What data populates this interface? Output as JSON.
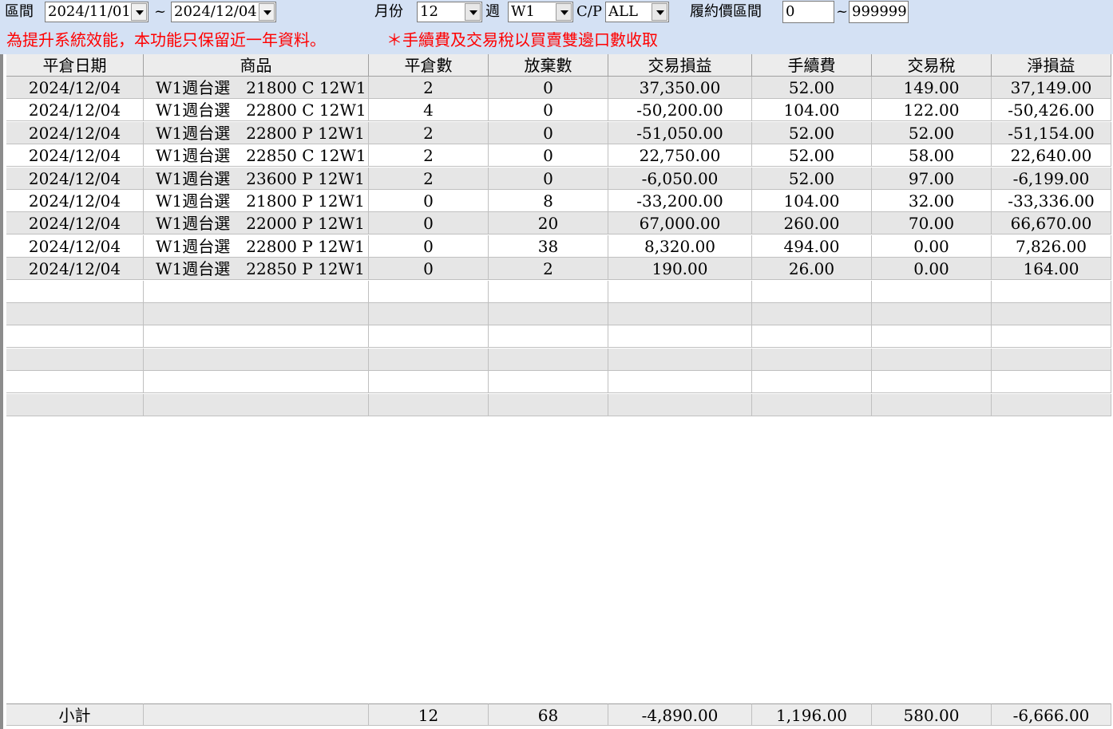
{
  "filters": {
    "range_label": "區間",
    "date_from": "2024/11/01",
    "tilde": "~",
    "date_to": "2024/12/04",
    "month_label": "月份",
    "month_value": "12",
    "week_label": "週",
    "week_value": "W1",
    "cp_label": "C/P",
    "cp_value": "ALL",
    "strike_label": "履約價區間",
    "strike_from": "0",
    "strike_to": "999999"
  },
  "notices": {
    "performance": "為提升系統效能，本功能只保留近一年資料。",
    "fee_note": "＊手續費及交易稅以買賣雙邊口數收取"
  },
  "table": {
    "columns": [
      "平倉日期",
      "商品",
      "平倉數",
      "放棄數",
      "交易損益",
      "手續費",
      "交易稅",
      "淨損益"
    ],
    "rows": [
      [
        "2024/12/04",
        "W1週台選　21800 C 12W1",
        "2",
        "0",
        "37,350.00",
        "52.00",
        "149.00",
        "37,149.00"
      ],
      [
        "2024/12/04",
        "W1週台選　22800 C 12W1",
        "4",
        "0",
        "-50,200.00",
        "104.00",
        "122.00",
        "-50,426.00"
      ],
      [
        "2024/12/04",
        "W1週台選　22800 P 12W1",
        "2",
        "0",
        "-51,050.00",
        "52.00",
        "52.00",
        "-51,154.00"
      ],
      [
        "2024/12/04",
        "W1週台選　22850 C 12W1",
        "2",
        "0",
        "22,750.00",
        "52.00",
        "58.00",
        "22,640.00"
      ],
      [
        "2024/12/04",
        "W1週台選　23600 P 12W1",
        "2",
        "0",
        "-6,050.00",
        "52.00",
        "97.00",
        "-6,199.00"
      ],
      [
        "2024/12/04",
        "W1週台選　21800 P 12W1",
        "0",
        "8",
        "-33,200.00",
        "104.00",
        "32.00",
        "-33,336.00"
      ],
      [
        "2024/12/04",
        "W1週台選　22000 P 12W1",
        "0",
        "20",
        "67,000.00",
        "260.00",
        "70.00",
        "66,670.00"
      ],
      [
        "2024/12/04",
        "W1週台選　22800 P 12W1",
        "0",
        "38",
        "8,320.00",
        "494.00",
        "0.00",
        "7,826.00"
      ],
      [
        "2024/12/04",
        "W1週台選　22850 P 12W1",
        "0",
        "2",
        "190.00",
        "26.00",
        "0.00",
        "164.00"
      ]
    ],
    "subtotal": [
      "小計",
      "",
      "12",
      "68",
      "-4,890.00",
      "1,196.00",
      "580.00",
      "-6,666.00"
    ]
  }
}
